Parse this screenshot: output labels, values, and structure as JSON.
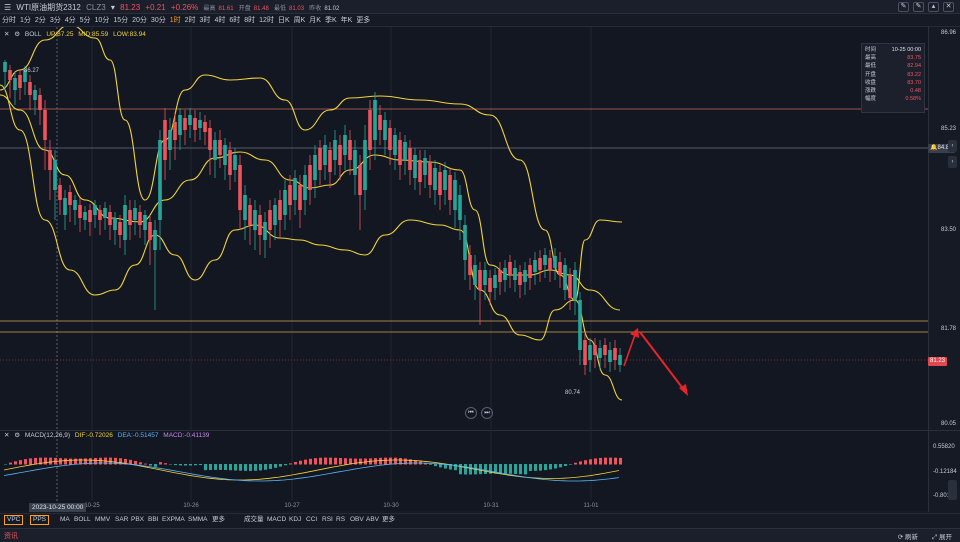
{
  "header": {
    "menu_icon": "menu-icon",
    "symbol": "WTI原油期货2312",
    "code": "CLZ3",
    "dropdown_icon": "chevron-down-icon",
    "price": "81.23",
    "change": "+0.21",
    "change_pct": "+0.26%",
    "high_label": "最高",
    "high": "81.61",
    "open_label": "开盘",
    "open": "81.48",
    "low_label": "最低",
    "low": "81.03",
    "prev_close_label": "昨收",
    "prev_close": "81.02",
    "window_icons": [
      "edit-icon",
      "edit-icon",
      "chevron-up-icon",
      "close-icon"
    ]
  },
  "timeframes": [
    "分时",
    "1分",
    "2分",
    "3分",
    "4分",
    "5分",
    "10分",
    "15分",
    "20分",
    "30分",
    "1时",
    "2时",
    "3时",
    "4时",
    "6时",
    "8时",
    "12时",
    "日K",
    "周K",
    "月K",
    "季K",
    "年K",
    "更多"
  ],
  "active_timeframe": "1时",
  "boll": {
    "name": "BOLL",
    "up": "UP:87.25",
    "mid": "MID:85.59",
    "low": "LOW:83.94"
  },
  "price_axis": [
    "86.96",
    "85.23",
    "83.50",
    "81.78",
    "80.05"
  ],
  "price_tags": [
    {
      "value": "84.89",
      "color": "#3a3f4d",
      "text_color": "#e0e3ea"
    },
    {
      "value": "81.23",
      "color": "#e0474f",
      "text_color": "#ffffff"
    }
  ],
  "annotations": {
    "high_mark": "86.27",
    "low_mark": "80.74"
  },
  "ohlc_box": {
    "rows": [
      {
        "label": "时间",
        "value": "10-25 00:00",
        "color": "#e0e3ea"
      },
      {
        "label": "最高",
        "value": "83.75",
        "color": "#f0535c"
      },
      {
        "label": "最低",
        "value": "82.94",
        "color": "#f0535c"
      },
      {
        "label": "开盘",
        "value": "83.22",
        "color": "#f0535c"
      },
      {
        "label": "收盘",
        "value": "83.70",
        "color": "#f0535c"
      },
      {
        "label": "涨跌",
        "value": "0.48",
        "color": "#f0535c"
      },
      {
        "label": "幅度",
        "value": "0.58%",
        "color": "#f0535c"
      }
    ]
  },
  "macd": {
    "name": "MACD(12,26,9)",
    "dif": "DIF:-0.72026",
    "dea": "DEA:-0.51457",
    "macd": "MACD:-0.41139",
    "axis": [
      "0.55820",
      "-0.12184",
      "-0.8018"
    ]
  },
  "date_axis": [
    "10-25",
    "10-26",
    "10-27",
    "10-30",
    "10-31",
    "11-01"
  ],
  "crosshair_date": "2023-10-25 00:00",
  "indicators": [
    "VPC",
    "PPS",
    "MA",
    "BOLL",
    "MMV",
    "SAR",
    "PBX",
    "BBI",
    "EXPMA",
    "SMMA",
    "更多",
    "成交量",
    "MACD",
    "KDJ",
    "CCI",
    "RSI",
    "RS",
    "OBV",
    "ABV",
    "更多"
  ],
  "bottom": {
    "news": "资讯",
    "refresh": "刷新",
    "expand": "展开"
  },
  "colors": {
    "up": "#f0535c",
    "down": "#26a69a",
    "boll": "#f2d33a",
    "accent": "#ff9f1a",
    "arrow": "#e8252b"
  }
}
